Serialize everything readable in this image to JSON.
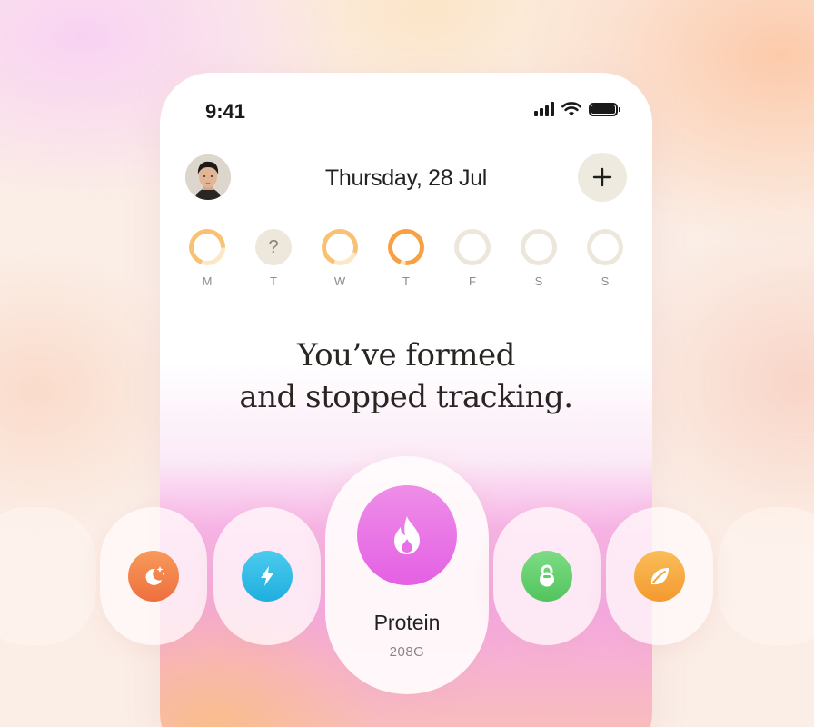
{
  "status": {
    "time": "9:41"
  },
  "header": {
    "date": "Thursday, 28 Jul"
  },
  "week": [
    {
      "label": "M",
      "progress": 0.7,
      "color": "#f8c173"
    },
    {
      "label": "T",
      "state": "unknown",
      "glyph": "?"
    },
    {
      "label": "W",
      "progress": 0.75,
      "color": "#f8c173"
    },
    {
      "label": "T",
      "progress": 0.95,
      "color": "#f7a044"
    },
    {
      "label": "F",
      "progress": 0
    },
    {
      "label": "S",
      "progress": 0
    },
    {
      "label": "S",
      "progress": 0
    }
  ],
  "headline": {
    "line1": "You’ve formed",
    "line2": "and stopped tracking."
  },
  "habits": [
    {
      "icon": "moon-stars-icon",
      "color": "#f07b48"
    },
    {
      "icon": "lightning-icon",
      "color": "#30b8e4"
    },
    {
      "icon": "flame-icon",
      "color": "#e56ae6",
      "name": "Protein",
      "value": "208G"
    },
    {
      "icon": "kettlebell-icon",
      "color": "#5fce6a"
    },
    {
      "icon": "leaf-icon",
      "color": "#f5a43c"
    }
  ]
}
